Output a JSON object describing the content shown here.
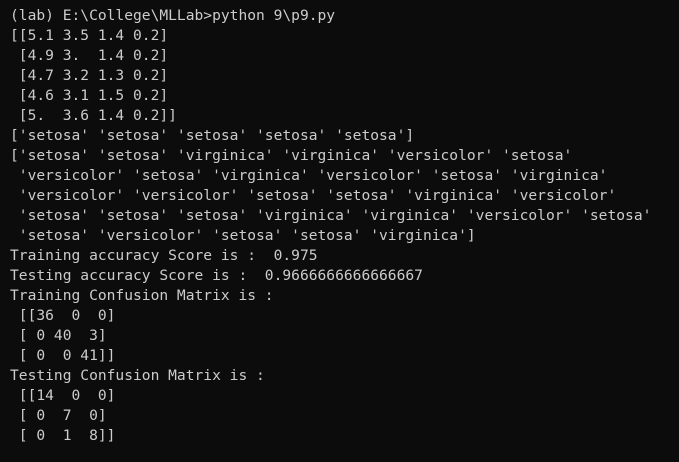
{
  "terminal": {
    "background_color": "#0c0c0c",
    "text_color": "#cccccc",
    "lines": [
      "(lab) E:\\College\\MLLab>python 9\\p9.py",
      "[[5.1 3.5 1.4 0.2]",
      " [4.9 3.  1.4 0.2]",
      " [4.7 3.2 1.3 0.2]",
      " [4.6 3.1 1.5 0.2]",
      " [5.  3.6 1.4 0.2]]",
      "['setosa' 'setosa' 'setosa' 'setosa' 'setosa']",
      "['setosa' 'setosa' 'virginica' 'virginica' 'versicolor' 'setosa'",
      " 'versicolor' 'setosa' 'virginica' 'versicolor' 'setosa' 'virginica'",
      " 'versicolor' 'versicolor' 'setosa' 'setosa' 'virginica' 'versicolor'",
      " 'setosa' 'setosa' 'setosa' 'virginica' 'virginica' 'versicolor' 'setosa'",
      " 'setosa' 'versicolor' 'setosa' 'setosa' 'virginica']",
      "Training accuracy Score is :  0.975",
      "Testing accuracy Score is :  0.9666666666666667",
      "Training Confusion Matrix is :",
      " [[36  0  0]",
      " [ 0 40  3]",
      " [ 0  0 41]]",
      "Testing Confusion Matrix is :",
      " [[14  0  0]",
      " [ 0  7  0]",
      " [ 0  1  8]]"
    ]
  }
}
